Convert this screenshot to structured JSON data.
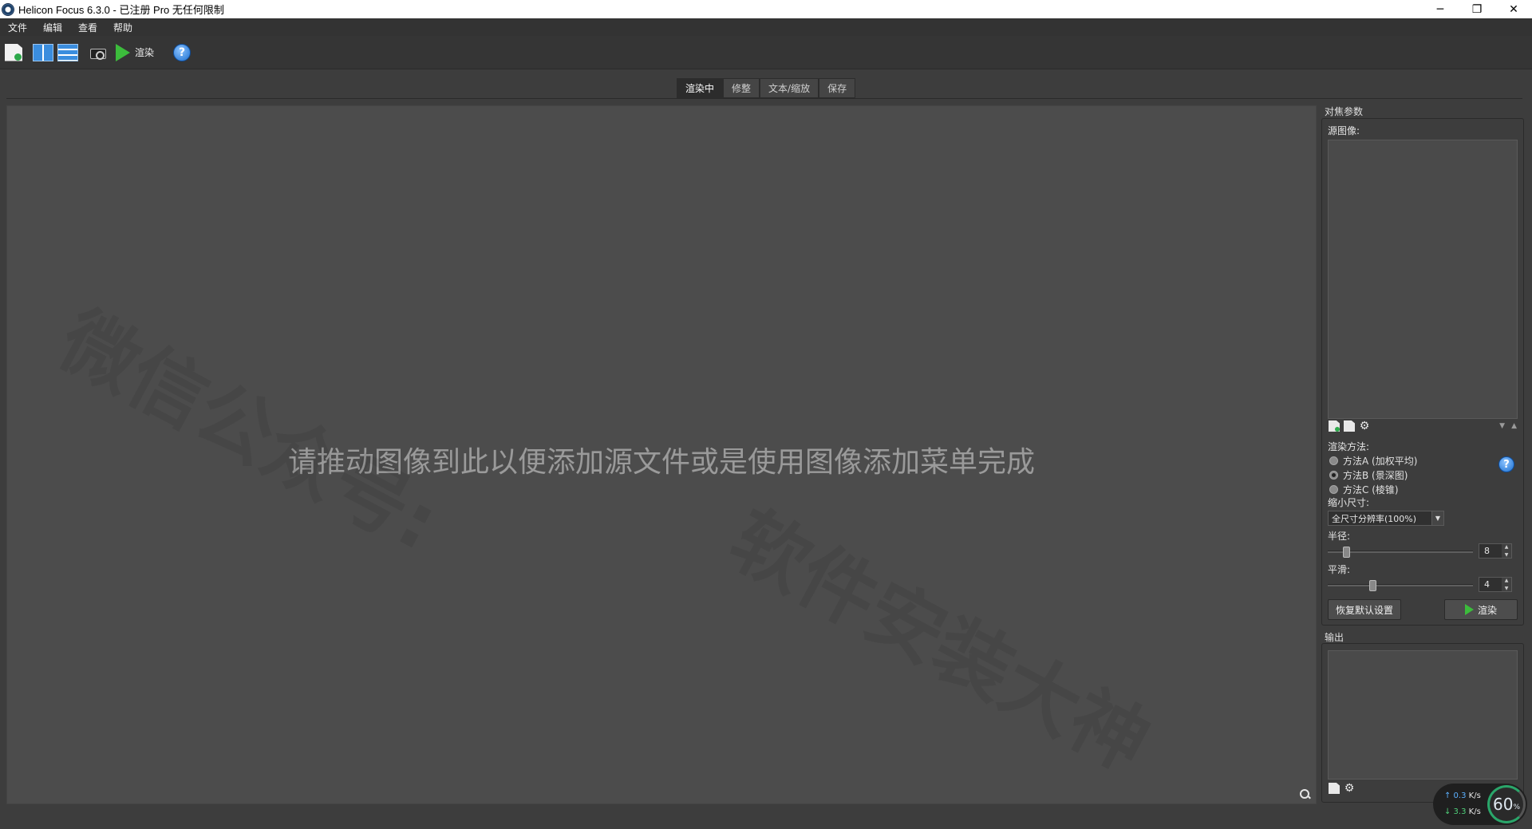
{
  "window": {
    "title": "Helicon Focus 6.3.0 - 已注册 Pro 无任何限制",
    "controls": [
      "─",
      "❐",
      "✕"
    ]
  },
  "menu": [
    "文件",
    "编辑",
    "查看",
    "帮助"
  ],
  "toolbar": {
    "icons": [
      "new-file-icon",
      "layout-columns-icon",
      "layout-rows-icon",
      "camera-icon",
      "play-icon",
      "help-icon"
    ],
    "render_label": "渲染",
    "help_glyph": "?"
  },
  "tabs": [
    {
      "label": "渲染中",
      "active": true
    },
    {
      "label": "修整",
      "active": false
    },
    {
      "label": "文本/缩放",
      "active": false
    },
    {
      "label": "保存",
      "active": false
    }
  ],
  "canvas": {
    "drop_hint": "请推动图像到此以便添加源文件或是使用图像添加菜单完成",
    "watermark_1": "微信公众号:",
    "watermark_2": "软件安装大神"
  },
  "focus_panel": {
    "title": "对焦参数",
    "source_label": "源图像:",
    "sort_arrows": [
      "▼",
      "▲"
    ],
    "method_label": "渲染方法:",
    "methods": [
      {
        "label": "方法A (加权平均)",
        "selected": false
      },
      {
        "label": "方法B (景深图)",
        "selected": true
      },
      {
        "label": "方法C (棱锥)",
        "selected": false
      }
    ],
    "help_glyph": "?",
    "reduce_label": "缩小尺寸:",
    "reduce_value": "全尺寸分辨率(100%)",
    "dropdown_arrow": "▼",
    "radius_label": "半径:",
    "radius_value": "8",
    "radius_fraction": 0.11,
    "smoothing_label": "平滑:",
    "smoothing_value": "4",
    "smoothing_fraction": 0.3,
    "spin_up": "▲",
    "spin_down": "▼",
    "reset_button": "恢复默认设置",
    "render_button": "渲染"
  },
  "output_panel": {
    "title": "输出"
  },
  "network": {
    "up_rate": "↑ 0.3",
    "up_unit": "K/s",
    "down_rate": "↓ 3.3",
    "down_unit": "K/s",
    "percent": "60",
    "percent_unit": "%"
  },
  "colors": {
    "background": "#3d3d3d",
    "canvas": "#4c4c4c",
    "accent_play": "#3cbc3c",
    "help_blue": "#1c6fd0"
  }
}
